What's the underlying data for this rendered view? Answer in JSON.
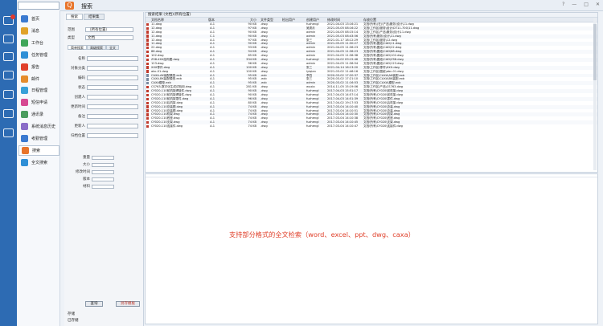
{
  "app": {
    "title": "搜索"
  },
  "nav": [
    {
      "label": "首页",
      "color": "#3b7ad0"
    },
    {
      "label": "消息",
      "color": "#e0a228"
    },
    {
      "label": "工作台",
      "color": "#3fa65a"
    },
    {
      "label": "任务管理",
      "color": "#2f8fd6"
    },
    {
      "label": "报告",
      "color": "#e0402b"
    },
    {
      "label": "邮件",
      "color": "#e58c2c"
    },
    {
      "label": "日程管理",
      "color": "#38a0d8"
    },
    {
      "label": "短信申请",
      "color": "#d64a92"
    },
    {
      "label": "通讯录",
      "color": "#4a9c5e"
    },
    {
      "label": "系统消息历史",
      "color": "#8a6cc8"
    },
    {
      "label": "考勤管理",
      "color": "#3b7ad0"
    },
    {
      "label": "搜索",
      "color": "#e8742a"
    },
    {
      "label": "全文搜索",
      "color": "#2f8fd6"
    }
  ],
  "left": {
    "tab_search": "搜索",
    "tab_result": "结果集",
    "range_label": "范围",
    "range_value": "（所有位置）",
    "type_label": "类型",
    "type_value": "文档",
    "subtab1": "简单搜索",
    "subtab2": "高级搜索",
    "subtab3": "全文",
    "fields": [
      "名称",
      "对象分类",
      "编码",
      "状态",
      "创建人",
      "更新时间",
      "备注",
      "更新人",
      "归档位置"
    ],
    "fields2": [
      "重量",
      "大小",
      "修改时间",
      "版本",
      "材料"
    ],
    "search_btn": "查询",
    "save_btn": "另存模板",
    "footer1": "存储",
    "footer2": "已存储"
  },
  "result": {
    "title": "搜索结果 (文档)(所有位置)",
    "columns": [
      "文档名称",
      "版本",
      "大小",
      "文件类型",
      "检出用户",
      "创建用户",
      "修改时间",
      "存放位置"
    ],
    "rows": [
      [
        "11.dwg",
        "A.1",
        "90 KB",
        ".dwg",
        "",
        "fuzhengl",
        "2021-04-03 13:16:21",
        "文档\\所有\\(在)\\产品\\服务\\设计\\11.dwg"
      ],
      [
        "12.dwg",
        "A.1",
        "97 KB",
        ".dwg",
        "",
        "吴秀月",
        "2021-05-05 08:16:22",
        "文档\\工作区\\服务\\设计\\DT11-700\\11.dwg"
      ],
      [
        "12.dwg",
        "A.1",
        "90 KB",
        ".dwg",
        "",
        "admin",
        "2021-04-05 08:15:14",
        "文档\\工作区\\产品\\服务\\设计\\11.dwg"
      ],
      [
        "11.dwg",
        "C.1",
        "90 KB",
        ".dwg",
        "",
        "admin",
        "2021-05-03 08:43:56",
        "文档\\所有\\服务\\设计\\11.dwg"
      ],
      [
        "12.dwg",
        "A.1",
        "97 KB",
        ".dwg",
        "",
        "张三",
        "2021-01-17 18:12:29",
        "文档\\工作区\\服务\\12.dwg"
      ],
      [
        "11.dwg",
        "A.1",
        "90 KB",
        ".dwg",
        "",
        "admin",
        "2021-05-05 11:30:27",
        "文档\\所有\\图纸\\CAD\\11.dwg"
      ],
      [
        "22.dwg",
        "A.1",
        "93 KB",
        ".dwg",
        "",
        "admin",
        "2021-04-05 11:36:23",
        "文档\\所有\\图纸\\CAD\\22.dwg"
      ],
      [
        "88.dwg",
        "A.1",
        "94 KB",
        ".dwg",
        "",
        "admin",
        "2021-04-05 11:36:23",
        "文档\\所有\\图纸\\CAD\\88.dwg"
      ],
      [
        "102.dwg",
        "A.1",
        "85 KB",
        ".dwg",
        "",
        "admin",
        "2021-04-05 11:36:38",
        "文档\\所有\\图纸\\CAD\\102.dwg"
      ],
      [
        "ZS8-XXX结构图.dwg",
        "A.1",
        "334 KB",
        ".dwg",
        "",
        "fuzhengl",
        "2021-04-02 09:15:46",
        "文档\\所有\\图纸\\CAD\\ZS8.dwg"
      ],
      [
        "123.dwg",
        "A.1",
        "96 KB",
        ".dwg",
        "",
        "admin",
        "2021-04-05 11:36:54",
        "文档\\所有\\图纸\\CAD\\123.dwg"
      ],
      [
        "XXX零件.dwg",
        "A.1",
        "100 KB",
        ".dwg",
        "",
        "张三",
        "2021-04-14 16:13:20",
        "文档\\工作区\\零件\\XXX.dwg"
      ],
      [
        "abc-01.dwg",
        "A.1",
        "100 KB",
        ".dwg",
        "",
        "lyiqian",
        "2021-03-02 11:46:16",
        "文档\\工作区\\图纸\\abc-01.dwg"
      ],
      [
        "CAXA-AK装配模型.exb",
        "A.1",
        "95 KB",
        ".exb",
        "",
        "李四",
        "2020-03-02 17:20:37",
        "文档\\工作区\\CAXA\\AK装配.exb"
      ],
      [
        "CAXA-BK装配模型.exb",
        "A.1",
        "95 KB",
        ".exb",
        "",
        "张三",
        "2020-03-02 17:21:10",
        "文档\\工作区\\CAXA\\BK装配.exb"
      ],
      [
        "CAXA模型.exb",
        "A.1",
        "95 KB",
        ".exb",
        "",
        "admin",
        "2020-03-02 11:16:53",
        "文档\\工作区\\CAXA\\模型.exb"
      ],
      [
        "CS763-数字化生成试验用.dwg",
        "A.1",
        "281 KB",
        ".dwg",
        "",
        "wuxia",
        "2014-11-05 15:19:06",
        "文档\\工作区\\产品\\CS763.dwg"
      ],
      [
        "CY020-110前机架焊接件.dwg",
        "A.1",
        "90 KB",
        ".dwg",
        "",
        "fuzhengl",
        "2017-04-03 15:51:17",
        "文档\\所有\\CY020\\前机架.dwg"
      ],
      [
        "CY020-110前机架焊接件.dwg",
        "A.1",
        "90 KB",
        ".dwg",
        "",
        "fuzhengl",
        "2017-04-03 14:57:14",
        "文档\\所有\\CY020\\前机架.dwg"
      ],
      [
        "CY020-110前机架零件.dwg",
        "A.1",
        "96 KB",
        ".dwg",
        "",
        "fuzhengl",
        "2017-04-03 14:51:39",
        "文档\\所有\\CY020\\零件.dwg"
      ],
      [
        "CY020-110后机架.dwg",
        "A.1",
        "80 KB",
        ".dwg",
        "",
        "fuzhengl",
        "2017-04-02 19:17:53",
        "文档\\所有\\CY020\\后机架.dwg"
      ],
      [
        "CY020-110总装图.dwg",
        "A.1",
        "74 KB",
        ".dwg",
        "",
        "fuzhengl",
        "2017-03-04 14:10:40",
        "文档\\所有\\CY020\\总装.dwg"
      ],
      [
        "CY020-110总装图.dwg",
        "A.1",
        "74 KB",
        ".dwg",
        "",
        "fuzhengl",
        "2017-03-04 14:10:51",
        "文档\\所有\\CY020\\总装.dwg"
      ],
      [
        "CY020-110机架.dwg",
        "A.1",
        "74 KB",
        ".dwg",
        "",
        "fuzhengl",
        "2017-03-04 14:10:30",
        "文档\\所有\\CY020\\机架.dwg"
      ],
      [
        "CY020-110底座.dwg",
        "A.1",
        "74 KB",
        ".dwg",
        "",
        "fuzhengl",
        "2017-03-04 14:10:38",
        "文档\\所有\\CY020\\底座.dwg"
      ],
      [
        "CY020-110支架.dwg",
        "A.1",
        "74 KB",
        ".dwg",
        "",
        "fuzhengl",
        "2017-03-04 14:10:45",
        "文档\\所有\\CY020\\支架.dwg"
      ],
      [
        "CY020-110连接件.dwg",
        "A.1",
        "74 KB",
        ".dwg",
        "",
        "fuzhengl",
        "2017-03-04 14:10:47",
        "文档\\所有\\CY020\\连接件.dwg"
      ]
    ]
  },
  "preview": {
    "message": "支持部分格式的全文检索（word、excel、ppt、dwg、caxa）"
  }
}
